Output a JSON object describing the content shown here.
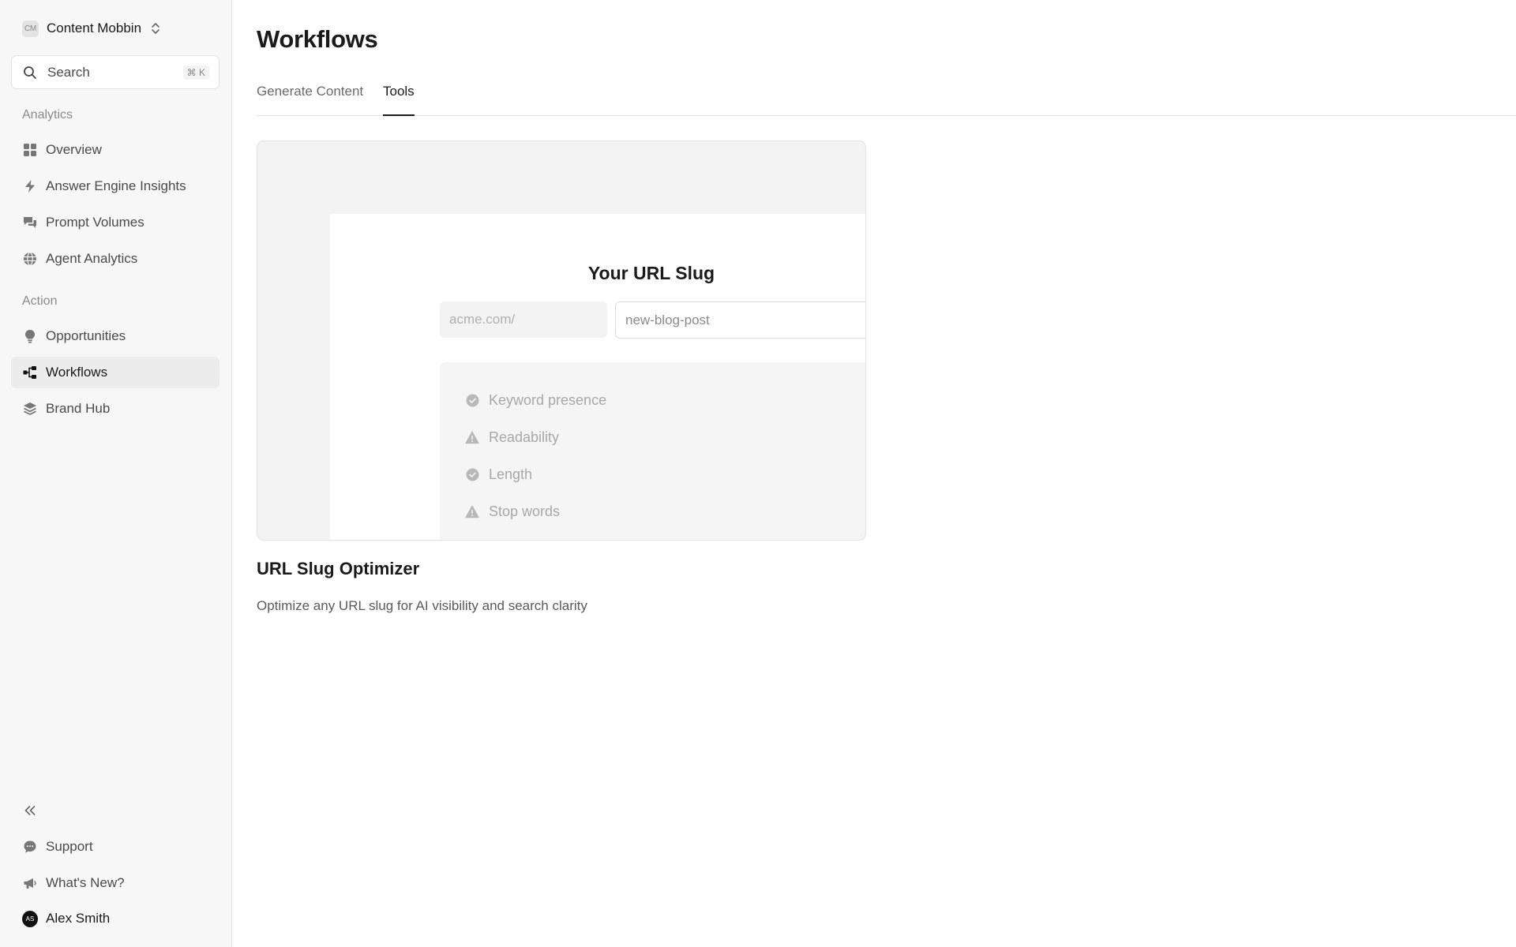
{
  "workspace": {
    "badge": "CM",
    "name": "Content Mobbin"
  },
  "search": {
    "label": "Search",
    "shortcut": "⌘ K"
  },
  "sidebar": {
    "analytics_label": "Analytics",
    "analytics_items": [
      {
        "label": "Overview",
        "icon": "grid-icon"
      },
      {
        "label": "Answer Engine Insights",
        "icon": "bolt-icon"
      },
      {
        "label": "Prompt Volumes",
        "icon": "chat-bubbles-icon"
      },
      {
        "label": "Agent Analytics",
        "icon": "globe-icon"
      }
    ],
    "action_label": "Action",
    "action_items": [
      {
        "label": "Opportunities",
        "icon": "lightbulb-icon"
      },
      {
        "label": "Workflows",
        "icon": "workflow-icon",
        "active": true
      },
      {
        "label": "Brand Hub",
        "icon": "layers-icon"
      }
    ],
    "footer_items": [
      {
        "label": "Support",
        "icon": "chat-icon"
      },
      {
        "label": "What's New?",
        "icon": "megaphone-icon"
      }
    ],
    "user": {
      "initials": "AS",
      "name": "Alex Smith"
    }
  },
  "page": {
    "title": "Workflows"
  },
  "tabs": [
    {
      "label": "Generate Content",
      "active": false
    },
    {
      "label": "Tools",
      "active": true
    }
  ],
  "tool_card": {
    "preview": {
      "title": "Your URL Slug",
      "domain_prefix": "acme.com/",
      "slug_value": "new-blog-post",
      "checks": [
        {
          "label": "Keyword presence",
          "status": "pass"
        },
        {
          "label": "Readability",
          "status": "warning"
        },
        {
          "label": "Length",
          "status": "pass"
        },
        {
          "label": "Stop words",
          "status": "warning"
        }
      ]
    },
    "title": "URL Slug Optimizer",
    "description": "Optimize any URL slug for AI visibility and search clarity"
  },
  "colors": {
    "sidebar_bg": "#f7f7f7",
    "active_item_bg": "#ececec",
    "text_primary": "#1a1a1a",
    "text_muted": "#8a8a8a"
  }
}
